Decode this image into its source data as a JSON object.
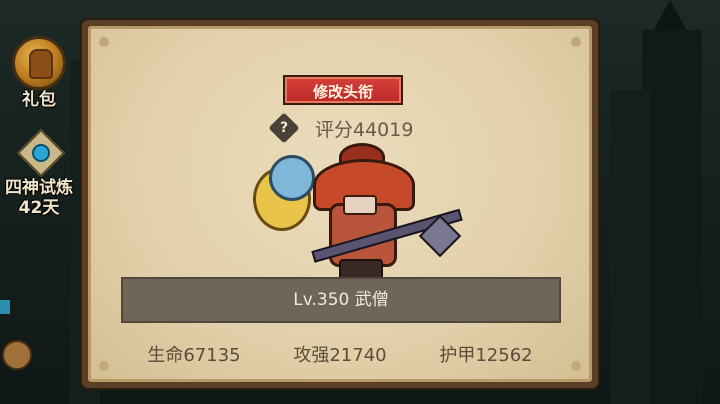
{
  "hud": {
    "gift_label": "礼包",
    "trial_label": "四神试炼",
    "trial_days": "42天"
  },
  "panel": {
    "edit_title_button": "修改头衔",
    "score_text": "评分44019",
    "help_icon": "question-diamond-icon",
    "hero_name": "Lv.350 武僧",
    "stats": [
      {
        "text": "生命67135"
      },
      {
        "text": "攻强21740"
      },
      {
        "text": "护甲12562"
      }
    ]
  },
  "colors": {
    "button_red": "#c8342e",
    "parchment": "#e2d0aa",
    "name_bar": "#6e6656"
  }
}
